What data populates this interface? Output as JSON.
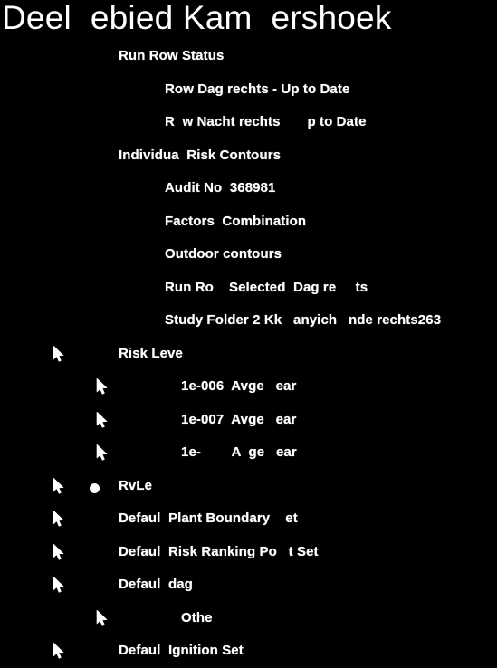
{
  "window": {
    "background_color": "#000000",
    "text_color": "#ffffff"
  },
  "header": {
    "title": "Deel  ebied Kam  ershoek"
  },
  "tree": {
    "rows": [
      {
        "label": "Run Row Status",
        "indent": 1,
        "marker": "none"
      },
      {
        "label": "Row Dag rechts - Up to Date",
        "indent": 2,
        "marker": "none"
      },
      {
        "label": "R  w Nacht rechts       p to Date",
        "indent": 2,
        "marker": "none"
      },
      {
        "label": "Individua  Risk Contours",
        "indent": 1,
        "marker": "none"
      },
      {
        "label": "Audit No  368981",
        "indent": 2,
        "marker": "none"
      },
      {
        "label": "Factors  Combination",
        "indent": 2,
        "marker": "none"
      },
      {
        "label": "Outdoor contours",
        "indent": 2,
        "marker": "none"
      },
      {
        "label": "Run Ro    Selected  Dag re     ts",
        "indent": 2,
        "marker": "none"
      },
      {
        "label": "Study Folder 2 Kk   anyich   nde rechts263",
        "indent": 2,
        "marker": "none"
      },
      {
        "label": "Risk Leve",
        "indent": 1,
        "marker": "cursor-a"
      },
      {
        "label": "1e-006  Avge   ear",
        "indent": 3,
        "marker": "cursor-b"
      },
      {
        "label": "1e-007  Avge   ear",
        "indent": 3,
        "marker": "cursor-b"
      },
      {
        "label": "1e-        A  ge   ear",
        "indent": 3,
        "marker": "cursor-b"
      },
      {
        "label": "RvLe",
        "indent": 1,
        "marker": "cursor-a-bullet"
      },
      {
        "label": "Defaul  Plant Boundary    et",
        "indent": 1,
        "marker": "cursor-a"
      },
      {
        "label": "Defaul  Risk Ranking Po   t Set",
        "indent": 1,
        "marker": "cursor-a"
      },
      {
        "label": "Defaul  dag",
        "indent": 1,
        "marker": "cursor-a"
      },
      {
        "label": "Othe",
        "indent": 3,
        "marker": "cursor-b"
      },
      {
        "label": "Defaul  Ignition Set",
        "indent": 1,
        "marker": "cursor-a"
      }
    ]
  },
  "icons": {
    "cursor": "mouse-cursor-icon",
    "bullet": "bullet-dot-icon"
  }
}
